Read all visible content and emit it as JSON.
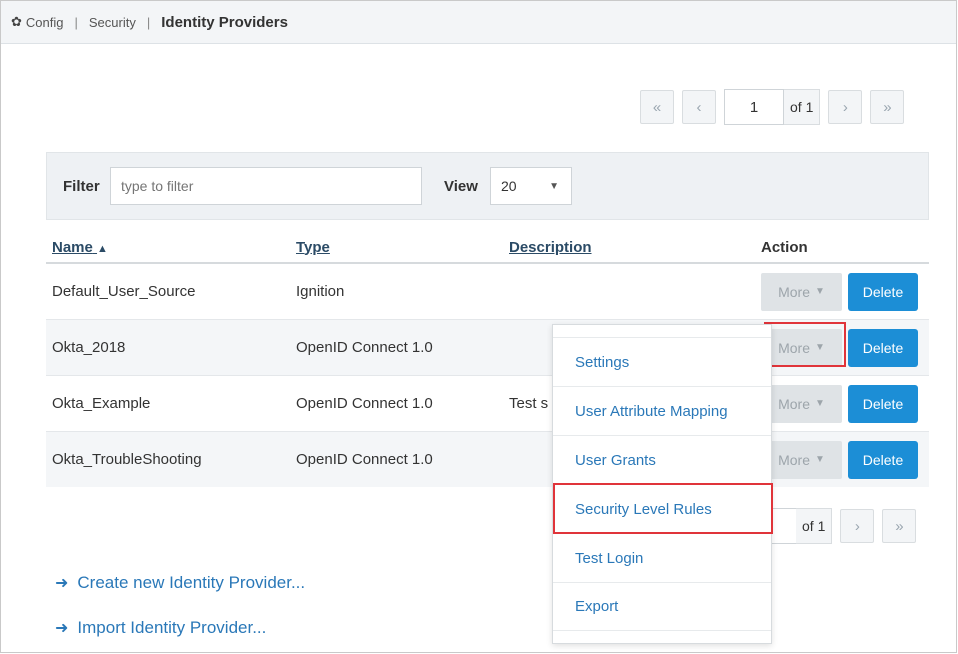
{
  "breadcrumb": {
    "items": [
      "Config",
      "Security"
    ],
    "current": "Identity Providers"
  },
  "pager_top": {
    "first": "«",
    "prev": "‹",
    "page": "1",
    "of": "of 1",
    "next": "›",
    "last": "»"
  },
  "pager_bottom": {
    "of": "of 1",
    "next": "›",
    "last": "»"
  },
  "filter": {
    "label": "Filter",
    "placeholder": "type to filter",
    "view_label": "View",
    "view_value": "20"
  },
  "table": {
    "columns": [
      "Name",
      "Type",
      "Description",
      "Action"
    ],
    "sort_indicator": "▲",
    "rows": [
      {
        "name": "Default_User_Source",
        "type": "Ignition",
        "description": ""
      },
      {
        "name": "Okta_2018",
        "type": "OpenID Connect 1.0",
        "description": ""
      },
      {
        "name": "Okta_Example",
        "type": "OpenID Connect 1.0",
        "description": "Test s"
      },
      {
        "name": "Okta_TroubleShooting",
        "type": "OpenID Connect 1.0",
        "description": ""
      }
    ],
    "more_label": "More",
    "delete_label": "Delete"
  },
  "dropdown": {
    "items": [
      "Settings",
      "User Attribute Mapping",
      "User Grants",
      "Security Level Rules",
      "Test Login",
      "Export"
    ],
    "highlighted": "Security Level Rules"
  },
  "links": {
    "create": "Create new Identity Provider...",
    "import": "Import Identity Provider..."
  },
  "colors": {
    "accent": "#1c8ed6",
    "link": "#2a78b8",
    "highlight": "#e0343a"
  }
}
